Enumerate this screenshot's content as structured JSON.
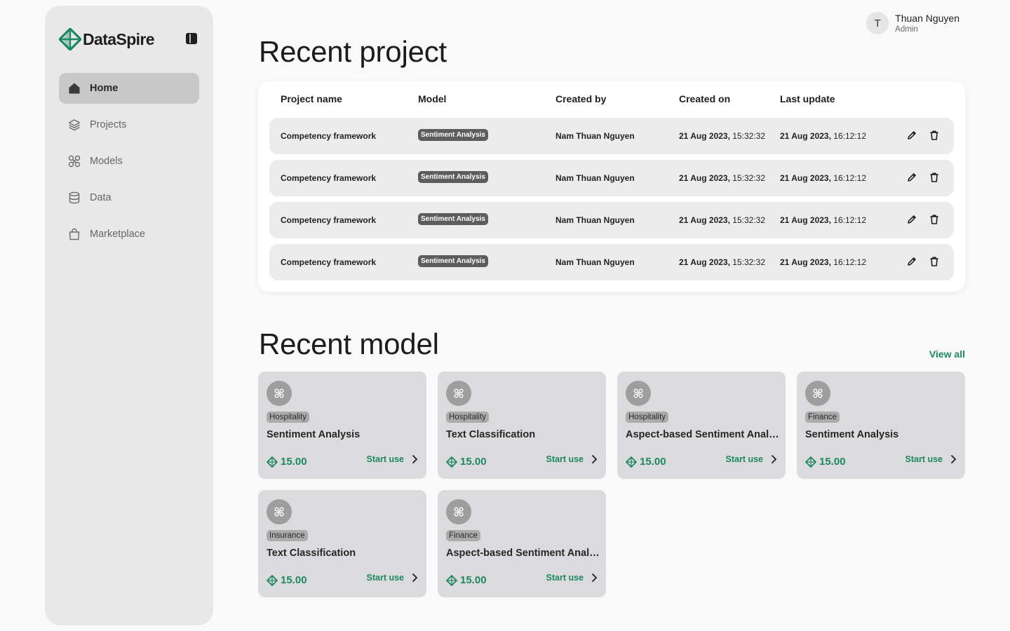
{
  "brand": {
    "name": "DataSpire",
    "accent": "#1d8860"
  },
  "nav": {
    "items": [
      {
        "label": "Home",
        "icon": "home-icon",
        "active": true
      },
      {
        "label": "Projects",
        "icon": "layers-icon",
        "active": false
      },
      {
        "label": "Models",
        "icon": "model-icon",
        "active": false
      },
      {
        "label": "Data",
        "icon": "database-icon",
        "active": false
      },
      {
        "label": "Marketplace",
        "icon": "shopping-bag-icon",
        "active": false
      }
    ]
  },
  "user": {
    "initial": "T",
    "name": "Thuan Nguyen",
    "role": "Admin"
  },
  "recent_project": {
    "title": "Recent project",
    "columns": [
      "Project name",
      "Model",
      "Created by",
      "Created on",
      "Last update"
    ],
    "rows": [
      {
        "name": "Competency framework",
        "model": "Sentiment Analysis",
        "created_by": "Nam Thuan Nguyen",
        "created_on_date": "21 Aug 2023,",
        "created_on_time": "15:32:32",
        "updated_date": "21 Aug 2023,",
        "updated_time": "16:12:12"
      },
      {
        "name": "Competency framework",
        "model": "Sentiment Analysis",
        "created_by": "Nam Thuan Nguyen",
        "created_on_date": "21 Aug 2023,",
        "created_on_time": "15:32:32",
        "updated_date": "21 Aug 2023,",
        "updated_time": "16:12:12"
      },
      {
        "name": "Competency framework",
        "model": "Sentiment Analysis",
        "created_by": "Nam Thuan Nguyen",
        "created_on_date": "21 Aug 2023,",
        "created_on_time": "15:32:32",
        "updated_date": "21 Aug 2023,",
        "updated_time": "16:12:12"
      },
      {
        "name": "Competency framework",
        "model": "Sentiment Analysis",
        "created_by": "Nam Thuan Nguyen",
        "created_on_date": "21 Aug 2023,",
        "created_on_time": "15:32:32",
        "updated_date": "21 Aug 2023,",
        "updated_time": "16:12:12"
      }
    ]
  },
  "recent_model": {
    "title": "Recent model",
    "view_all": "View all",
    "start_label": "Start use",
    "cards": [
      {
        "tag": "Hospitality",
        "title": "Sentiment Analysis",
        "price": "15.00"
      },
      {
        "tag": "Hospitality",
        "title": "Text Classification",
        "price": "15.00"
      },
      {
        "tag": "Hospitality",
        "title": "Aspect-based Sentiment Analysis",
        "price": "15.00"
      },
      {
        "tag": "Finance",
        "title": "Sentiment Analysis",
        "price": "15.00"
      },
      {
        "tag": "Insurance",
        "title": "Text Classification",
        "price": "15.00"
      },
      {
        "tag": "Finance",
        "title": "Aspect-based Sentiment Analysis",
        "price": "15.00"
      }
    ]
  }
}
